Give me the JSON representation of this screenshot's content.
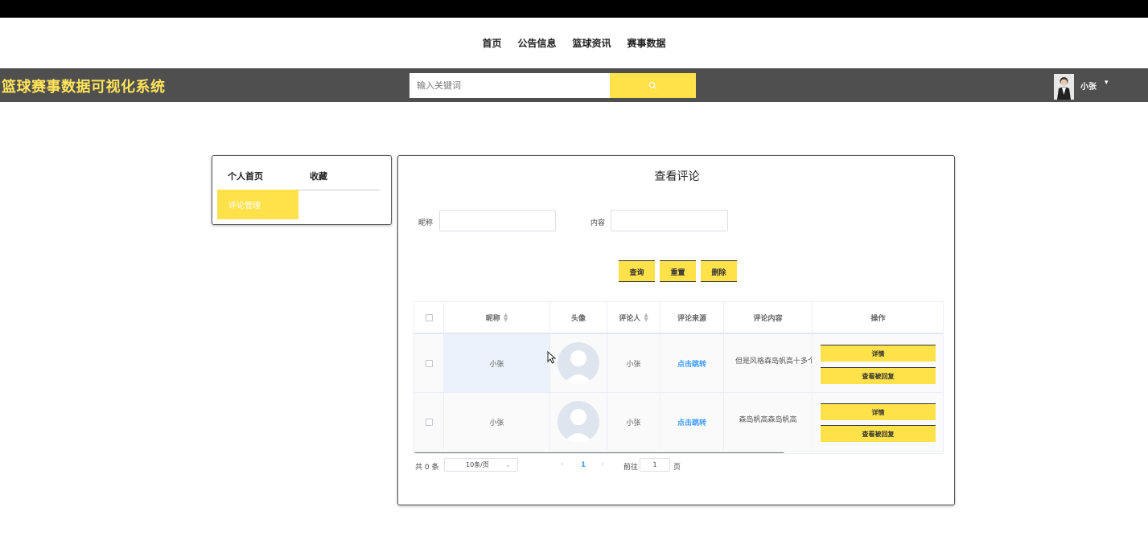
{
  "nav": {
    "items": [
      {
        "label": "首页"
      },
      {
        "label": "公告信息"
      },
      {
        "label": "篮球资讯"
      },
      {
        "label": "赛事数据"
      }
    ]
  },
  "header": {
    "brand": "篮球赛事数据可视化系统",
    "search_placeholder": "输入关键词",
    "username": "小张",
    "caret": "▾",
    "brand_color": "#ffe45a",
    "accent_color": "#ffe14a",
    "bar_color": "#4f4f4f"
  },
  "sidebar": {
    "tabs": [
      {
        "label": "个人首页"
      },
      {
        "label": "收藏"
      }
    ],
    "active_item": "评论管理"
  },
  "main": {
    "title": "查看评论",
    "filters": {
      "nickname_label": "昵称",
      "content_label": "内容"
    },
    "buttons": {
      "query": "查询",
      "reset": "重置",
      "delete": "删除"
    },
    "table": {
      "headers": {
        "nickname": "昵称",
        "avatar": "头像",
        "commenter": "评论人",
        "source": "评论来源",
        "content": "评论内容",
        "actions": "操作"
      },
      "rows": [
        {
          "nickname": "小张",
          "commenter": "小张",
          "source": "点击跳转",
          "content": "但是风格森岛帆高十多个",
          "detail": "详情",
          "reply": "查看被回复"
        },
        {
          "nickname": "小张",
          "commenter": "小张",
          "source": "点击跳转",
          "content": "森岛帆高森岛帆高",
          "detail": "详情",
          "reply": "查看被回复"
        }
      ]
    },
    "pagination": {
      "total": "共 0 条",
      "page_size": "10条/页",
      "prev": "‹",
      "current_page": "1",
      "next": "›",
      "goto_label": "前往",
      "goto_value": "1",
      "page_suffix": "页"
    }
  }
}
